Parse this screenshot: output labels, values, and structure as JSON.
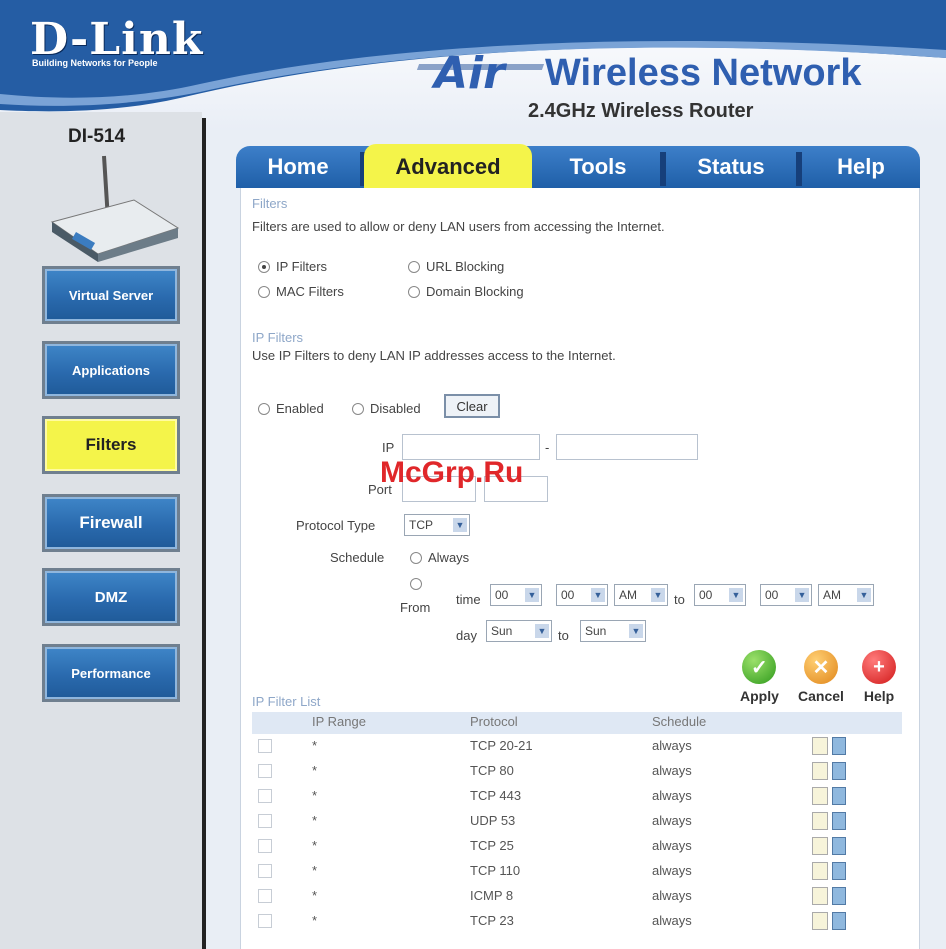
{
  "header": {
    "brand": "D-Link",
    "tagline": "Building Networks for People",
    "title_air": "Air",
    "title_rest": "Wireless Network",
    "subtitle": "2.4GHz Wireless Router"
  },
  "sidebar": {
    "model": "DI-514",
    "items": [
      {
        "label": "Virtual Server",
        "active": false
      },
      {
        "label": "Applications",
        "active": false
      },
      {
        "label": "Filters",
        "active": true
      },
      {
        "label": "Firewall",
        "active": false
      },
      {
        "label": "DMZ",
        "active": false
      },
      {
        "label": "Performance",
        "active": false
      }
    ]
  },
  "tabs": [
    {
      "label": "Home",
      "active": false
    },
    {
      "label": "Advanced",
      "active": true
    },
    {
      "label": "Tools",
      "active": false
    },
    {
      "label": "Status",
      "active": false
    },
    {
      "label": "Help",
      "active": false
    }
  ],
  "filters": {
    "title": "Filters",
    "description": "Filters are used to allow or deny LAN users from accessing the Internet.",
    "options": [
      {
        "label": "IP Filters",
        "selected": true
      },
      {
        "label": "URL Blocking",
        "selected": false
      },
      {
        "label": "MAC Filters",
        "selected": false
      },
      {
        "label": "Domain Blocking",
        "selected": false
      }
    ]
  },
  "ip_filters": {
    "title": "IP Filters",
    "description": "Use IP Filters to deny LAN IP addresses access to the Internet.",
    "enabled_label": "Enabled",
    "disabled_label": "Disabled",
    "clear_label": "Clear",
    "ip_label": "IP",
    "ip_separator": "-",
    "port_label": "Port",
    "protocol_label": "Protocol Type",
    "protocol_value": "TCP",
    "schedule_label": "Schedule",
    "always_label": "Always",
    "from_label": "From",
    "time_label": "time",
    "to_label": "to",
    "day_label": "day",
    "time_from_hour": "00",
    "time_from_min": "00",
    "time_from_ampm": "AM",
    "time_to_hour": "00",
    "time_to_min": "00",
    "time_to_ampm": "AM",
    "day_from": "Sun",
    "day_to": "Sun"
  },
  "actions": {
    "apply": "Apply",
    "cancel": "Cancel",
    "help": "Help"
  },
  "table": {
    "title": "IP Filter List",
    "headers": [
      "IP Range",
      "Protocol",
      "Schedule"
    ],
    "rows": [
      {
        "ip": "*",
        "protocol": "TCP 20-21",
        "schedule": "always"
      },
      {
        "ip": "*",
        "protocol": "TCP 80",
        "schedule": "always"
      },
      {
        "ip": "*",
        "protocol": "TCP 443",
        "schedule": "always"
      },
      {
        "ip": "*",
        "protocol": "UDP 53",
        "schedule": "always"
      },
      {
        "ip": "*",
        "protocol": "TCP 25",
        "schedule": "always"
      },
      {
        "ip": "*",
        "protocol": "TCP 110",
        "schedule": "always"
      },
      {
        "ip": "*",
        "protocol": "ICMP 8",
        "schedule": "always"
      },
      {
        "ip": "*",
        "protocol": "TCP 23",
        "schedule": "always"
      }
    ]
  },
  "watermark": "McGrp.Ru",
  "colors": {
    "accent_blue": "#2a6aae",
    "active_yellow": "#f4f44a",
    "title_blue": "#2f5fb0"
  }
}
